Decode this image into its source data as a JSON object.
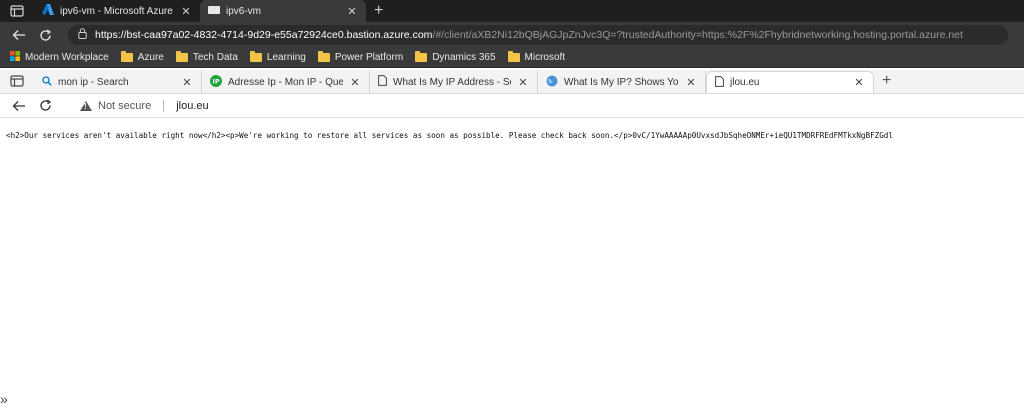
{
  "outer_browser": {
    "tabs": [
      {
        "label": "ipv6-vm - Microsoft Azure",
        "icon": "azure-icon",
        "active": false
      },
      {
        "label": "ipv6-vm",
        "icon": "remote-desktop-icon",
        "active": true
      }
    ],
    "address": {
      "url_host": "https://bst-caa97a02-4832-4714-9d29-e55a72924ce0.bastion.azure.com",
      "url_rest": "/#/client/aXB2Ni12bQBjAGJpZnJvc3Q=?trustedAuthority=https:%2F%2Fhybridnetworking.hosting.portal.azure.net"
    },
    "bookmarks": [
      {
        "label": "Modern Workplace"
      },
      {
        "label": "Azure"
      },
      {
        "label": "Tech Data"
      },
      {
        "label": "Learning"
      },
      {
        "label": "Power Platform"
      },
      {
        "label": "Dynamics 365"
      },
      {
        "label": "Microsoft"
      }
    ]
  },
  "inner_browser": {
    "tabs": [
      {
        "label": "mon ip - Search",
        "icon": "search-icon"
      },
      {
        "label": "Adresse Ip - Mon IP - Quel est m",
        "icon": "ip-icon"
      },
      {
        "label": "What Is My IP Address - See You",
        "icon": "page-icon"
      },
      {
        "label": "What Is My IP? Shows Your Publ",
        "icon": "globe-icon"
      },
      {
        "label": "jlou.eu",
        "icon": "page-icon",
        "active": true
      }
    ],
    "address": {
      "security": "Not secure",
      "site": "jlou.eu"
    }
  },
  "page": {
    "body_text": "<h2>Our services aren't available right now</h2><p>We're working to restore all services as soon as possible. Please check back soon.</p>0vC/1YwAAAAAp0UvxsdJbSqheONMEr+ieQU1TMDRFREdFMTkxNgBFZGdl"
  },
  "colors": {
    "azure_blue": "#0078d4",
    "folder_yellow": "#f2c548",
    "ip_green": "#1fa33a"
  }
}
